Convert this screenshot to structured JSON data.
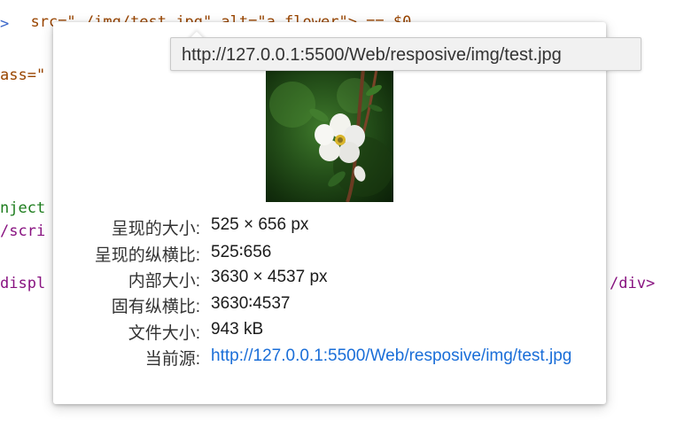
{
  "code": {
    "line1": "src=\"./img/test.jpg\" alt=\"a flower\"> == $0",
    "line2_arrow": ">",
    "line3": "ass=\"",
    "line4": "nject",
    "line5": "/scri",
    "line6": "displ",
    "line6_end": "/div>"
  },
  "tooltip": {
    "url": "http://127.0.0.1:5500/Web/resposive/img/test.jpg"
  },
  "image_info": {
    "rendered_size_label": "呈现的大小:",
    "rendered_size_value": "525 × 656 px",
    "rendered_ratio_label": "呈现的纵横比:",
    "rendered_ratio_value": "525∶656",
    "intrinsic_size_label": "内部大小:",
    "intrinsic_size_value": "3630 × 4537 px",
    "intrinsic_ratio_label": "固有纵横比:",
    "intrinsic_ratio_value": "3630∶4537",
    "file_size_label": "文件大小:",
    "file_size_value": "943 kB",
    "current_source_label": "当前源:",
    "current_source_value": "http://127.0.0.1:5500/Web/resposive/img/test.jpg"
  }
}
